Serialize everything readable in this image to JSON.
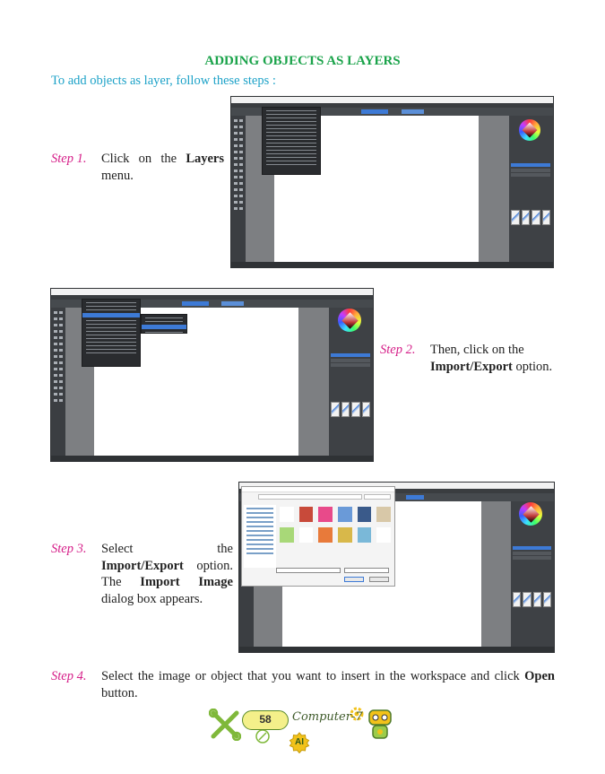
{
  "heading": "ADDING OBJECTS AS LAYERS",
  "intro": "To add objects as layer, follow these steps :",
  "steps": [
    {
      "number": "Step 1.",
      "parts": [
        "Click on the ",
        "Layers",
        " menu."
      ]
    },
    {
      "number": "Step 2.",
      "parts": [
        "Then, click on the ",
        "Import/Export",
        " option."
      ]
    },
    {
      "number": "Step 3.",
      "parts": [
        "Select the ",
        "Import/Export",
        " option. The ",
        "Import Image",
        " dialog box appears."
      ]
    },
    {
      "number": "Step 4.",
      "parts": [
        "Select the image or object that you want to insert in the workspace and click ",
        "Open",
        " button."
      ]
    }
  ],
  "footer": {
    "page_number": "58",
    "book_title": "Computer-7",
    "badge": "AI"
  },
  "colors": {
    "heading": "#1aa34a",
    "intro": "#1da2c8",
    "step_number": "#d6218a",
    "app_dark": "#4a4e52",
    "highlight": "#3d7ad6"
  },
  "icons": [
    "tools-icon",
    "gear-icon",
    "robot-icon",
    "ai-badge-icon"
  ]
}
